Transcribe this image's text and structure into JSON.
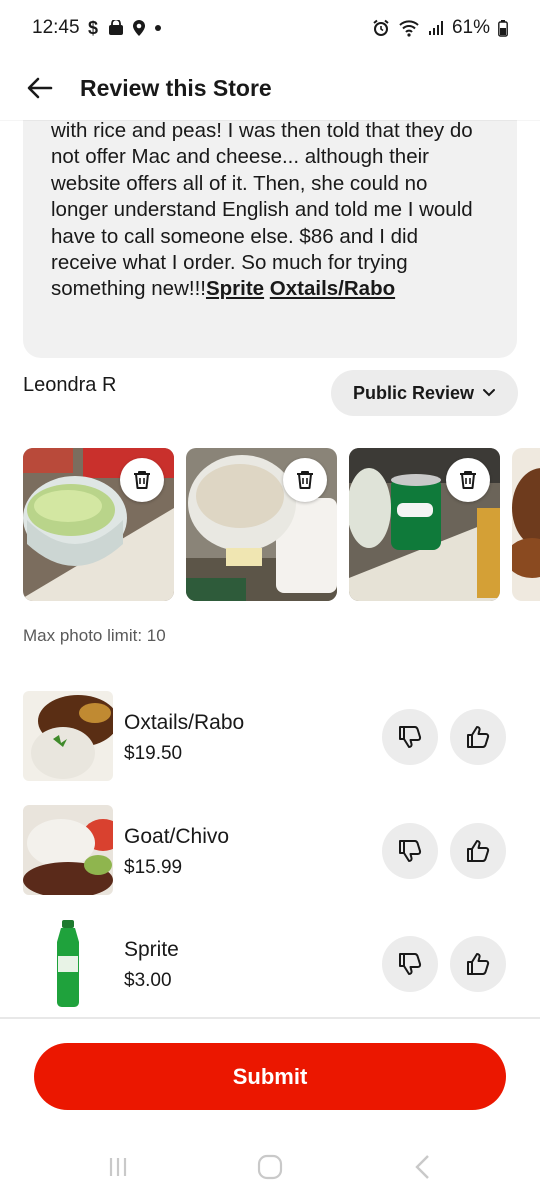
{
  "status_bar": {
    "time": "12:45",
    "left_icons": [
      "dollar-icon",
      "shopping-bag-icon",
      "location-pin-icon",
      "dot-icon"
    ],
    "right_icons": [
      "alarm-icon",
      "wifi-icon",
      "signal-icon",
      "battery-icon"
    ],
    "battery": "61%"
  },
  "header": {
    "back_icon": "arrow-left-icon",
    "title": "Review this Store"
  },
  "review": {
    "text": "with rice and peas! I was then told that they do not offer Mac and cheese... although their website offers all of it. Then, she could no longer understand English and told me I would have to call someone else. $86 and I did receive what I order.  So much for trying something new!!!",
    "tags": [
      "Sprite",
      "Oxtails/Rabo"
    ]
  },
  "reviewer": {
    "name": "Leondra R",
    "visibility": "Public Review",
    "visibility_icon": "chevron-down-icon"
  },
  "photos": {
    "items": [
      {
        "subject": "lettuce container",
        "delete_icon": "trash-icon"
      },
      {
        "subject": "rice container",
        "delete_icon": "trash-icon"
      },
      {
        "subject": "sprite can",
        "delete_icon": "trash-icon"
      },
      {
        "subject": "oxtail dish"
      }
    ],
    "limit_text": "Max photo limit: 10"
  },
  "items": [
    {
      "name": "Oxtails/Rabo",
      "price": "$19.50"
    },
    {
      "name": "Goat/Chivo",
      "price": "$15.99"
    },
    {
      "name": "Sprite",
      "price": "$3.00"
    }
  ],
  "vote_icons": {
    "down": "thumbs-down-icon",
    "up": "thumbs-up-icon"
  },
  "submit": {
    "label": "Submit"
  },
  "colors": {
    "accent": "#eb1700",
    "chip_bg": "#ececec",
    "review_bg": "#f1f1f1"
  },
  "navbar": {
    "icons": [
      "recents-icon",
      "home-icon",
      "back-icon"
    ]
  }
}
